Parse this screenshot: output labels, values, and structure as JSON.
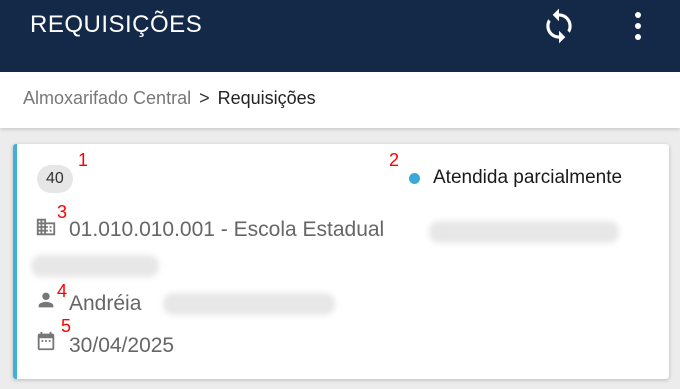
{
  "appbar": {
    "title": "REQUISIÇÕES",
    "refresh_icon": "refresh-icon",
    "menu_icon": "more-vert-icon",
    "background_color": "#132947"
  },
  "breadcrumb": {
    "parent": "Almoxarifado Central",
    "separator": ">",
    "current": "Requisições"
  },
  "card": {
    "number": "40",
    "status": "Atendida parcialmente",
    "status_color": "#3aa8d8",
    "accent_color": "#3fb0da",
    "unit": "01.010.010.001 - Escola Estadual",
    "unit_icon": "building-icon",
    "user": "Andréia",
    "user_icon": "person-icon",
    "date": "30/04/2025",
    "date_icon": "calendar-icon"
  },
  "annotations": [
    "1",
    "2",
    "3",
    "4",
    "5"
  ]
}
